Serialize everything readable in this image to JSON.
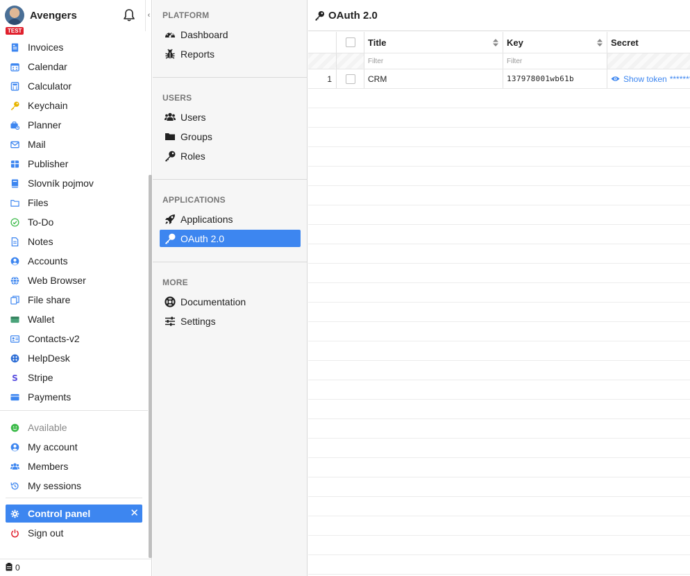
{
  "app": {
    "org_name": "Avengers",
    "env_badge": "TEST",
    "collapse_glyph": "‹"
  },
  "sidebar": {
    "items": [
      {
        "id": "invoices",
        "label": "Invoices",
        "icon": "invoice-icon",
        "color": "#3d86f0"
      },
      {
        "id": "calendar",
        "label": "Calendar",
        "icon": "calendar-icon",
        "color": "#3d86f0"
      },
      {
        "id": "calculator",
        "label": "Calculator",
        "icon": "calculator-icon",
        "color": "#3d86f0"
      },
      {
        "id": "keychain",
        "label": "Keychain",
        "icon": "key-icon",
        "color": "#e8b500"
      },
      {
        "id": "planner",
        "label": "Planner",
        "icon": "planner-icon",
        "color": "#3d86f0"
      },
      {
        "id": "mail",
        "label": "Mail",
        "icon": "mail-icon",
        "color": "#3d86f0"
      },
      {
        "id": "publisher",
        "label": "Publisher",
        "icon": "publisher-icon",
        "color": "#3d86f0"
      },
      {
        "id": "slovnik",
        "label": "Slovník pojmov",
        "icon": "book-icon",
        "color": "#3d86f0"
      },
      {
        "id": "files",
        "label": "Files",
        "icon": "folder-icon",
        "color": "#3d86f0"
      },
      {
        "id": "todo",
        "label": "To-Do",
        "icon": "check-circle-icon",
        "color": "#3dbb4a"
      },
      {
        "id": "notes",
        "label": "Notes",
        "icon": "note-icon",
        "color": "#3d86f0"
      },
      {
        "id": "accounts",
        "label": "Accounts",
        "icon": "user-circle-icon",
        "color": "#3d86f0"
      },
      {
        "id": "web-browser",
        "label": "Web Browser",
        "icon": "globe-icon",
        "color": "#3d86f0"
      },
      {
        "id": "file-share",
        "label": "File share",
        "icon": "copy-icon",
        "color": "#3d86f0"
      },
      {
        "id": "wallet",
        "label": "Wallet",
        "icon": "wallet-icon",
        "color": "#4aa37a"
      },
      {
        "id": "contacts",
        "label": "Contacts-v2",
        "icon": "contact-card-icon",
        "color": "#3d86f0"
      },
      {
        "id": "helpdesk",
        "label": "HelpDesk",
        "icon": "helpdesk-icon",
        "color": "#2f6fd6"
      },
      {
        "id": "stripe",
        "label": "Stripe",
        "icon": "stripe-icon",
        "color": "#5a4fe0"
      },
      {
        "id": "payments",
        "label": "Payments",
        "icon": "credit-card-icon",
        "color": "#3d86f0"
      }
    ],
    "account_items": [
      {
        "id": "available",
        "label": "Available",
        "icon": "smiley-icon",
        "color": "#3dbb4a"
      },
      {
        "id": "my-account",
        "label": "My account",
        "icon": "user-circle-icon",
        "color": "#3d86f0"
      },
      {
        "id": "members",
        "label": "Members",
        "icon": "users-icon",
        "color": "#3d86f0"
      },
      {
        "id": "my-sessions",
        "label": "My sessions",
        "icon": "history-icon",
        "color": "#3d86f0"
      }
    ],
    "control_panel": {
      "label": "Control panel",
      "close": "✕"
    },
    "sign_out": {
      "label": "Sign out",
      "color": "#e0202d"
    },
    "footer_count": "0"
  },
  "nav": {
    "sections": [
      {
        "title": "PLATFORM",
        "items": [
          {
            "id": "dashboard",
            "label": "Dashboard",
            "icon": "dashboard-icon"
          },
          {
            "id": "reports",
            "label": "Reports",
            "icon": "bug-icon"
          }
        ]
      },
      {
        "title": "USERS",
        "items": [
          {
            "id": "users",
            "label": "Users",
            "icon": "users-icon"
          },
          {
            "id": "groups",
            "label": "Groups",
            "icon": "folder-icon"
          },
          {
            "id": "roles",
            "label": "Roles",
            "icon": "key-icon"
          }
        ]
      },
      {
        "title": "APPLICATIONS",
        "items": [
          {
            "id": "applications",
            "label": "Applications",
            "icon": "rocket-icon"
          },
          {
            "id": "oauth",
            "label": "OAuth 2.0",
            "icon": "key-icon",
            "active": true
          }
        ]
      },
      {
        "title": "MORE",
        "items": [
          {
            "id": "documentation",
            "label": "Documentation",
            "icon": "lifebuoy-icon"
          },
          {
            "id": "settings",
            "label": "Settings",
            "icon": "sliders-icon"
          }
        ]
      }
    ]
  },
  "main": {
    "title": "OAuth 2.0",
    "columns": {
      "title": "Title",
      "key": "Key",
      "secret": "Secret"
    },
    "filter_placeholder": "Filter",
    "rows": [
      {
        "num": "1",
        "title": "CRM",
        "key": "137978001wb61b",
        "secret_link": "Show token",
        "secret_mask": "********"
      }
    ]
  },
  "colors": {
    "accent": "#3d86f0",
    "danger": "#e0202d",
    "nav_bg": "#f6f6f6"
  }
}
